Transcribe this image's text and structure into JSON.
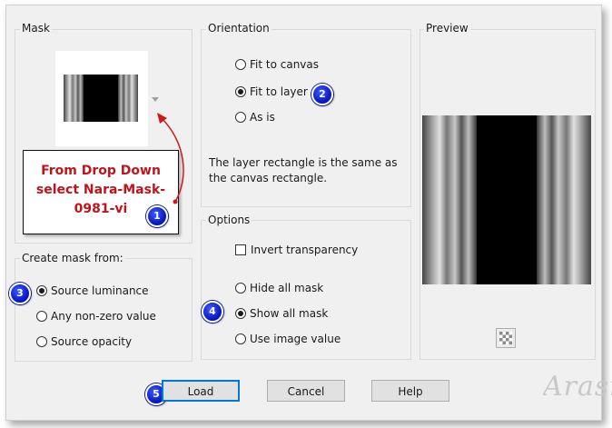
{
  "mask": {
    "legend": "Mask",
    "dropdown_arrow_icon": "triangle-down",
    "annotation_text": "From Drop Down select Nara-Mask-0981-vi",
    "annotation_badge": "1"
  },
  "create_mask_from": {
    "legend": "Create mask from:",
    "badge": "3",
    "options": [
      {
        "label": "Source luminance",
        "checked": true
      },
      {
        "label": "Any non-zero value",
        "checked": false
      },
      {
        "label": "Source opacity",
        "checked": false
      }
    ]
  },
  "orientation": {
    "legend": "Orientation",
    "badge": "2",
    "options": [
      {
        "label": "Fit to canvas",
        "checked": false
      },
      {
        "label": "Fit to layer",
        "checked": true
      },
      {
        "label": "As is",
        "checked": false
      }
    ],
    "description": "The layer rectangle is the same as the canvas rectangle."
  },
  "options": {
    "legend": "Options",
    "badge": "4",
    "invert_label": "Invert transparency",
    "invert_checked": false,
    "radios": [
      {
        "label": "Hide all mask",
        "checked": false
      },
      {
        "label": "Show all mask",
        "checked": true
      },
      {
        "label": "Use image value",
        "checked": false
      }
    ]
  },
  "preview": {
    "legend": "Preview",
    "toggle_icon": "checkerboard-icon"
  },
  "buttons": {
    "load": "Load",
    "cancel": "Cancel",
    "help": "Help",
    "load_badge": "5"
  },
  "watermark": "Arasimages",
  "colors": {
    "annotation_text": "#c0141c",
    "badge": "#0a1cc8",
    "arrow": "#d01818",
    "default_button_border": "#0078d7"
  }
}
